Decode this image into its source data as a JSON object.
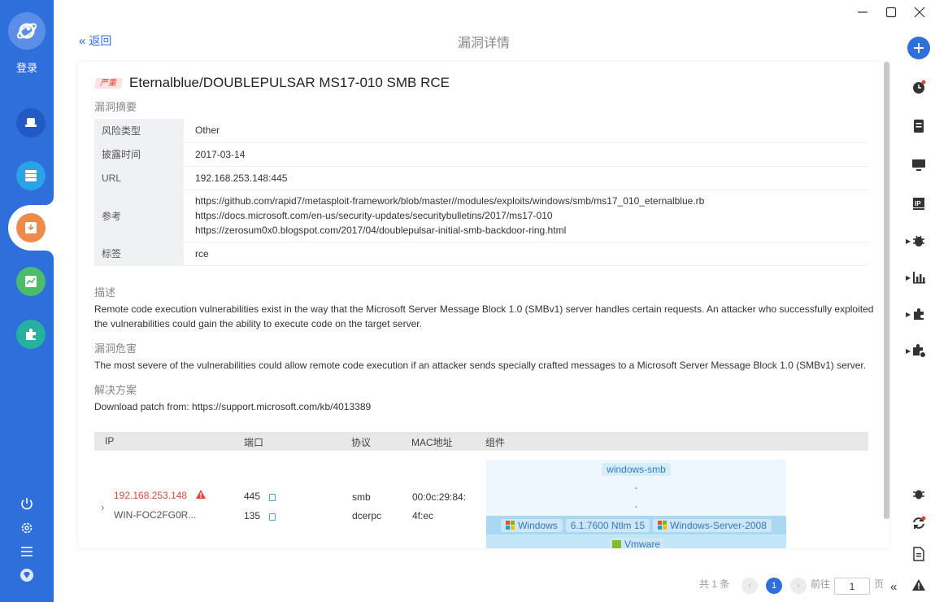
{
  "sidebar": {
    "login_label": "登录",
    "nav": [
      {
        "icon": "hat-icon",
        "color": "#2259c2"
      },
      {
        "icon": "server-icon",
        "color": "#29a3e6"
      },
      {
        "icon": "vuln-icon",
        "color": "#f08a4b"
      },
      {
        "icon": "chart-icon",
        "color": "#4cbb6a"
      },
      {
        "icon": "plugin-icon",
        "color": "#27b0a0"
      }
    ],
    "bottom": [
      "power-icon",
      "settings-icon",
      "menu-icon",
      "diamond-icon"
    ]
  },
  "header": {
    "back_label": "返回",
    "page_title": "漏洞详情"
  },
  "vuln": {
    "severity": "严重",
    "title": "Eternalblue/DOUBLEPULSAR MS17-010 SMB RCE",
    "summary_label": "漏洞摘要",
    "rows": {
      "risk_type": {
        "key": "风险类型",
        "value": "Other"
      },
      "disclosure": {
        "key": "披露时间",
        "value": "2017-03-14"
      },
      "url": {
        "key": "URL",
        "value": "192.168.253.148:445"
      },
      "reference": {
        "key": "参考",
        "lines": [
          "https://github.com/rapid7/metasploit-framework/blob/master//modules/exploits/windows/smb/ms17_010_eternalblue.rb",
          "https://docs.microsoft.com/en-us/security-updates/securitybulletins/2017/ms17-010",
          "https://zerosum0x0.blogspot.com/2017/04/doublepulsar-initial-smb-backdoor-ring.html"
        ]
      },
      "tags": {
        "key": "标签",
        "value": "rce"
      }
    },
    "description_label": "描述",
    "description": "Remote code execution vulnerabilities exist in the way that the Microsoft Server Message Block 1.0 (SMBv1) server handles certain requests. An attacker who successfully exploited the vulnerabilities could gain the ability to execute code on the target server.",
    "impact_label": "漏洞危害",
    "impact": "The most severe of the vulnerabilities could allow remote code execution if an attacker sends specially crafted messages to a Microsoft Server Message Block 1.0 (SMBv1) server.",
    "solution_label": "解决方案",
    "solution": "Download patch from: https://support.microsoft.com/kb/4013389"
  },
  "assets": {
    "columns": {
      "ip": "IP",
      "port": "端口",
      "protocol": "协议",
      "mac": "MAC地址",
      "component": "组件"
    },
    "row": {
      "ip": "192.168.253.148",
      "host": "WIN-FOC2FG0R...",
      "ports": [
        "445",
        "135"
      ],
      "protocols": [
        "smb",
        "dcerpc"
      ],
      "mac_lines": [
        "00:0c:29:84:",
        "4f:ec"
      ],
      "components": {
        "row1": "windows-smb",
        "row2": "-",
        "row3": "-",
        "os_name": "Windows",
        "os_version": "6.1.7600 Ntlm 15",
        "os_server": "Windows-Server-2008",
        "vm": "Vmware"
      }
    }
  },
  "pagination": {
    "total": "共 1 条",
    "current": "1",
    "goto_label": "前往",
    "page_input": "1",
    "page_suffix": "页"
  },
  "colors": {
    "primary": "#2f6fdc",
    "danger": "#e0463a",
    "component_bg": "#eef7fd"
  }
}
